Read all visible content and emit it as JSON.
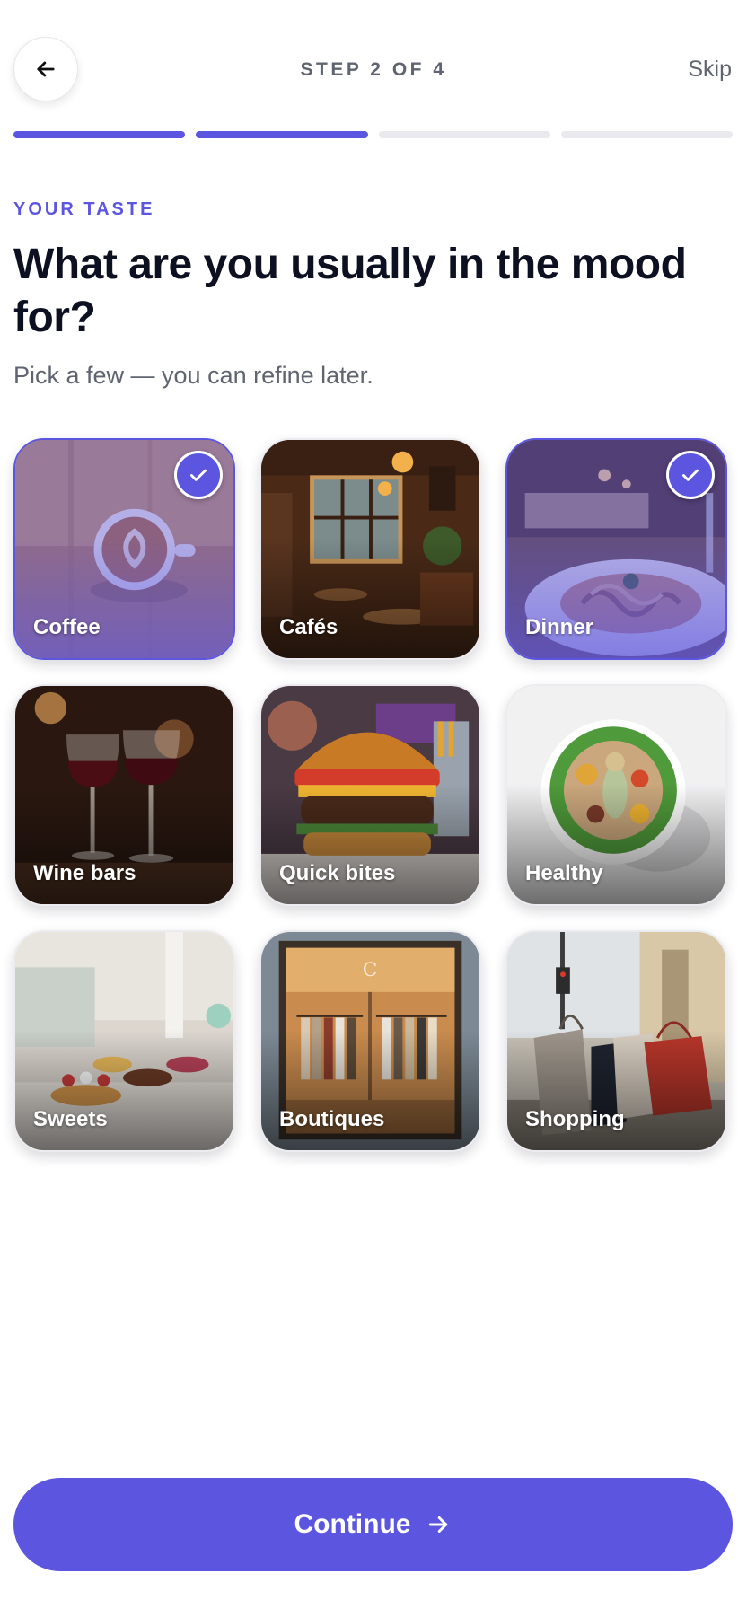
{
  "header": {
    "back_icon": "arrow-left-icon",
    "step_label": "STEP 2 OF 4",
    "skip_label": "Skip",
    "progress": {
      "current_step": 2,
      "total_steps": 4
    }
  },
  "intro": {
    "eyebrow": "YOUR TASTE",
    "headline": "What are you usually in the mood for?",
    "subtitle": "Pick a few — you can refine later."
  },
  "categories": [
    {
      "id": "coffee",
      "label": "Coffee",
      "selected": true
    },
    {
      "id": "cafes",
      "label": "Cafés",
      "selected": false
    },
    {
      "id": "dinner",
      "label": "Dinner",
      "selected": true
    },
    {
      "id": "wine-bars",
      "label": "Wine bars",
      "selected": false
    },
    {
      "id": "quick-bites",
      "label": "Quick bites",
      "selected": false
    },
    {
      "id": "healthy",
      "label": "Healthy",
      "selected": false
    },
    {
      "id": "sweets",
      "label": "Sweets",
      "selected": false
    },
    {
      "id": "boutiques",
      "label": "Boutiques",
      "selected": false
    },
    {
      "id": "shopping",
      "label": "Shopping",
      "selected": false
    }
  ],
  "footer": {
    "continue_label": "Continue",
    "continue_icon": "arrow-right-icon"
  },
  "colors": {
    "accent": "#5b55e0",
    "progress_inactive": "#e9e9ee",
    "text_primary": "#0d1020",
    "text_secondary": "#5f6470"
  }
}
